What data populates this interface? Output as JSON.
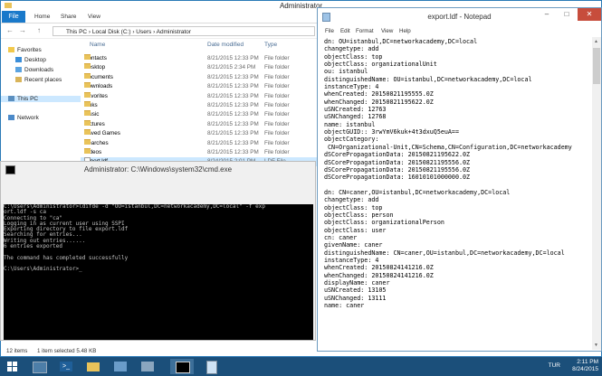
{
  "explorer": {
    "title": "Administrator",
    "ribbon_tabs": [
      "File",
      "Home",
      "Share",
      "View"
    ],
    "address_parts": "This PC  ›  Local Disk (C:)  ›  Users  ›  Administrator",
    "nav": {
      "favorites": "Favorites",
      "desktop": "Desktop",
      "downloads": "Downloads",
      "recent": "Recent places",
      "this_pc": "This PC",
      "network": "Network"
    },
    "columns": {
      "name": "Name",
      "date": "Date modified",
      "type": "Type"
    },
    "files": [
      {
        "name": "Contacts",
        "date": "8/21/2015 12:33 PM",
        "type": "File folder"
      },
      {
        "name": "Desktop",
        "date": "8/21/2015 2:34 PM",
        "type": "File folder"
      },
      {
        "name": "Documents",
        "date": "8/21/2015 12:33 PM",
        "type": "File folder"
      },
      {
        "name": "Downloads",
        "date": "8/21/2015 12:33 PM",
        "type": "File folder"
      },
      {
        "name": "Favorites",
        "date": "8/21/2015 12:33 PM",
        "type": "File folder"
      },
      {
        "name": "Links",
        "date": "8/21/2015 12:33 PM",
        "type": "File folder"
      },
      {
        "name": "Music",
        "date": "8/21/2015 12:33 PM",
        "type": "File folder"
      },
      {
        "name": "Pictures",
        "date": "8/21/2015 12:33 PM",
        "type": "File folder"
      },
      {
        "name": "Saved Games",
        "date": "8/21/2015 12:33 PM",
        "type": "File folder"
      },
      {
        "name": "Searches",
        "date": "8/21/2015 12:33 PM",
        "type": "File folder"
      },
      {
        "name": "Videos",
        "date": "8/21/2015 12:33 PM",
        "type": "File folder"
      },
      {
        "name": "export.ldf",
        "date": "8/24/2015 2:01 PM",
        "type": "LDF File"
      }
    ],
    "status": {
      "items": "12 items",
      "selected": "1 item selected  5.48 KB"
    }
  },
  "cmd": {
    "title": "Administrator: C:\\Windows\\system32\\cmd.exe",
    "lines": [
      "C:\\Users\\Administrator>ldifde -d \"OU=istanbul,DC=networkacademy,DC=local\" -f exp",
      "ort.ldf -s ca",
      "Connecting to \"ca\"",
      "Logging in as current user using SSPI",
      "Exporting directory to file export.ldf",
      "Searching for entries...",
      "Writing out entries......",
      "6 entries exported",
      "",
      "The command has completed successfully",
      "",
      "C:\\Users\\Administrator>_"
    ]
  },
  "notepad": {
    "title": "export.ldf - Notepad",
    "menu": [
      "File",
      "Edit",
      "Format",
      "View",
      "Help"
    ],
    "lines": [
      "dn: OU=istanbul,DC=networkacademy,DC=local",
      "changetype: add",
      "objectClass: top",
      "objectClass: organizationalUnit",
      "ou: istanbul",
      "distinguishedName: OU=istanbul,DC=networkacademy,DC=local",
      "instanceType: 4",
      "whenCreated: 20150821195555.0Z",
      "whenChanged: 20150821195622.0Z",
      "uSNCreated: 12763",
      "uSNChanged: 12768",
      "name: istanbul",
      "objectGUID:: 3rwYmV6kuk+4t3dxuQ5euA==",
      "objectCategory:",
      " CN=Organizational-Unit,CN=Schema,CN=Configuration,DC=networkacademy",
      "dSCorePropagationData: 20150821195622.0Z",
      "dSCorePropagationData: 20150821195556.0Z",
      "dSCorePropagationData: 20150821195556.0Z",
      "dSCorePropagationData: 16010101000000.0Z",
      "",
      "dn: CN=caner,OU=istanbul,DC=networkacademy,DC=local",
      "changetype: add",
      "objectClass: top",
      "objectClass: person",
      "objectClass: organizationalPerson",
      "objectClass: user",
      "cn: caner",
      "givenName: caner",
      "distinguishedName: CN=caner,OU=istanbul,DC=networkacademy,DC=local",
      "instanceType: 4",
      "whenCreated: 20150824141216.0Z",
      "whenChanged: 20150824141216.0Z",
      "displayName: caner",
      "uSNCreated: 13105",
      "uSNChanged: 13111",
      "name: caner"
    ]
  },
  "taskbar": {
    "time": "2:11 PM",
    "date": "8/24/2015",
    "lang": "TUR"
  }
}
